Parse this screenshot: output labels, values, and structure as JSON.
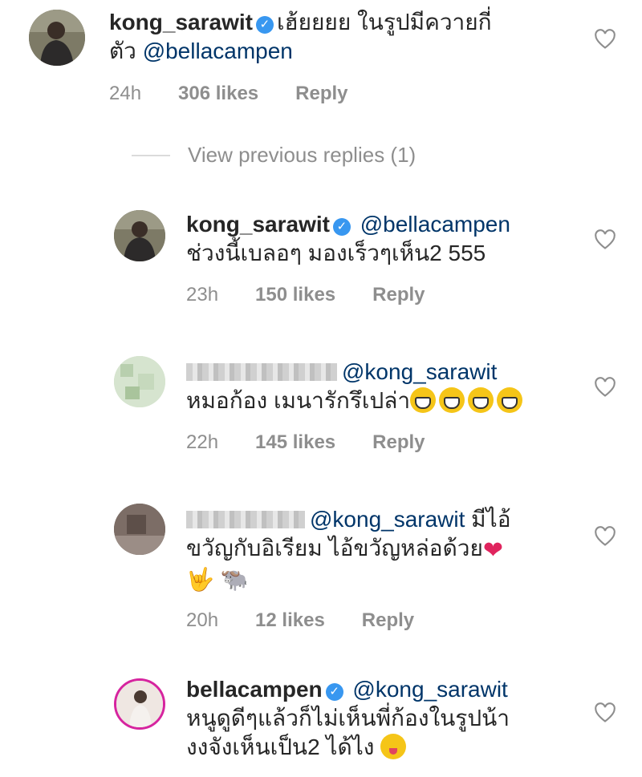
{
  "colors": {
    "mention": "#003569",
    "meta": "#8e8e8e",
    "verified": "#3897f0",
    "text": "#262626"
  },
  "comments": [
    {
      "username": "kong_sarawit",
      "text_line1": "เฮ้ยยยย ในรูปมีควายกี่",
      "text_line2_prefix": "ตัว ",
      "mention": "@bellacampen",
      "time": "24h",
      "likes": "306 likes",
      "reply": "Reply"
    },
    {
      "username": "kong_sarawit",
      "mention": "@bellacampen",
      "text_line2": "ช่วงนี้เบลอๆ มองเร็วๆเห็น2 555",
      "time": "23h",
      "likes": "150 likes",
      "reply": "Reply"
    },
    {
      "mention": "@kong_sarawit",
      "text_line2": "หมอก้อง เมนารักรึเปล่า",
      "time": "22h",
      "likes": "145 likes",
      "reply": "Reply"
    },
    {
      "mention": "@kong_sarawit",
      "text_line1_suffix": " มีไอ้",
      "text_line2": "ขวัญกับอิเรียม ไอ้ขวัญหล่อด้วย",
      "time": "20h",
      "likes": "12 likes",
      "reply": "Reply"
    },
    {
      "username": "bellacampen",
      "mention": "@kong_sarawit",
      "text_line2": "หนูดูดีๆแล้วก็ไม่เห็นพี่ก้องในรูปน้า",
      "text_line3": "งงจังเห็นเป็น2 ได้ไง",
      "time": "",
      "likes": "",
      "reply": ""
    }
  ],
  "view_previous": "View previous replies (1)",
  "icons": {
    "heart": "heart-outline-icon",
    "verified": "verified-badge-icon"
  }
}
